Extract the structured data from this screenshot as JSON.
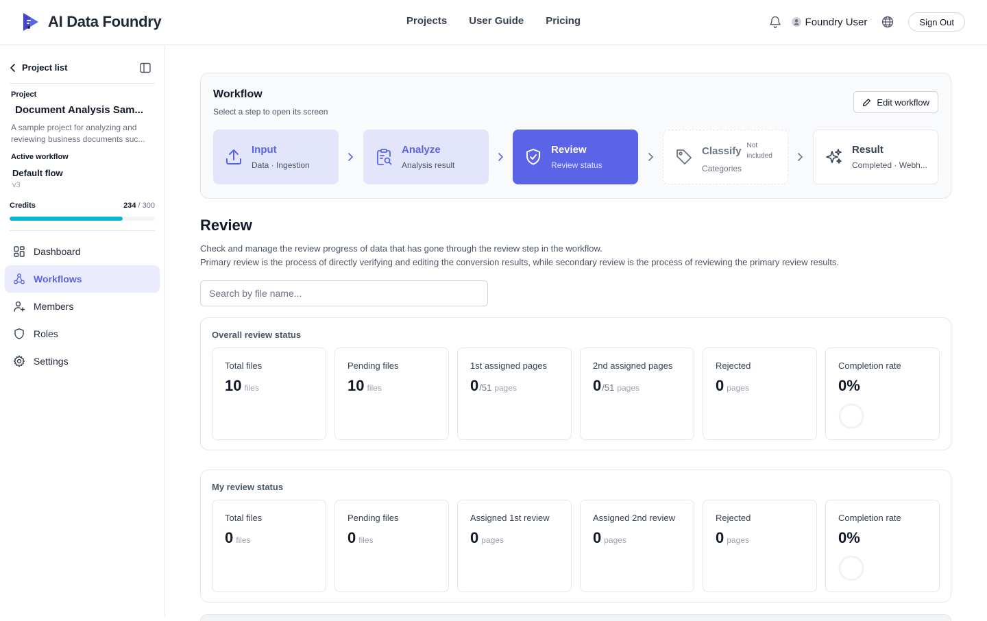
{
  "brand": {
    "name": "AI Data Foundry"
  },
  "topnav": {
    "items": [
      "Projects",
      "User Guide",
      "Pricing"
    ]
  },
  "user": {
    "name": "Foundry User",
    "signout": "Sign Out"
  },
  "sidebar": {
    "back_label": "Project list",
    "project_label": "Project",
    "project_name": "Document Analysis Sam...",
    "description_line1": "A sample project for analyzing and",
    "description_line2": "reviewing business documents suc...",
    "active_workflow_label": "Active workflow",
    "workflow_name": "Default flow",
    "workflow_version": "v3",
    "credits_label": "Credits",
    "credits_used": "234",
    "credits_total": "/ 300",
    "credits_fraction": 0.78,
    "menu": [
      {
        "label": "Dashboard",
        "icon": "dashboard-icon",
        "active": false
      },
      {
        "label": "Workflows",
        "icon": "workflow-icon",
        "active": true
      },
      {
        "label": "Members",
        "icon": "add-user-icon",
        "active": false
      },
      {
        "label": "Roles",
        "icon": "shield-icon",
        "active": false
      },
      {
        "label": "Settings",
        "icon": "gear-icon",
        "active": false
      }
    ]
  },
  "workflow": {
    "title": "Workflow",
    "subtitle": "Select a step to open its screen",
    "edit_label": "Edit workflow",
    "steps": [
      {
        "title": "Input",
        "subtitle": "Data · Ingestion",
        "icon": "upload-icon"
      },
      {
        "title": "Analyze",
        "subtitle": "Analysis result",
        "icon": "clipboard-search-icon"
      },
      {
        "title": "Review",
        "subtitle": "Review status",
        "icon": "shield-check-icon"
      },
      {
        "title": "Classify",
        "subtitle": "Categories",
        "note_line1": "Not",
        "note_line2": "included",
        "icon": "tag-icon"
      },
      {
        "title": "Result",
        "subtitle": "Completed · Webh...",
        "icon": "sparkles-icon"
      }
    ]
  },
  "review": {
    "title": "Review",
    "desc_line1": "Check and manage the review progress of data that has gone through the review step in the workflow.",
    "desc_line2": "Primary review is the process of directly verifying and editing the conversion results, while secondary review is the process of reviewing the primary review results.",
    "search_placeholder": "Search by file name..."
  },
  "overall": {
    "title": "Overall review status",
    "tiles": [
      {
        "label": "Total files",
        "value": "10",
        "den": "",
        "unit": "files"
      },
      {
        "label": "Pending files",
        "value": "10",
        "den": "",
        "unit": "files"
      },
      {
        "label": "1st assigned pages",
        "value": "0",
        "den": "/51",
        "unit": "pages"
      },
      {
        "label": "2nd assigned pages",
        "value": "0",
        "den": "/51",
        "unit": "pages"
      },
      {
        "label": "Rejected",
        "value": "0",
        "den": "",
        "unit": "pages"
      },
      {
        "label": "Completion rate",
        "value": "0%",
        "den": "",
        "unit": "",
        "completion": 0
      }
    ]
  },
  "mine": {
    "title": "My review status",
    "tiles": [
      {
        "label": "Total files",
        "value": "0",
        "den": "",
        "unit": "files"
      },
      {
        "label": "Pending files",
        "value": "0",
        "den": "",
        "unit": "files"
      },
      {
        "label": "Assigned 1st review",
        "value": "0",
        "den": "",
        "unit": "pages"
      },
      {
        "label": "Assigned 2nd review",
        "value": "0",
        "den": "",
        "unit": "pages"
      },
      {
        "label": "Rejected",
        "value": "0",
        "den": "",
        "unit": "pages"
      },
      {
        "label": "Completion rate",
        "value": "0%",
        "den": "",
        "unit": "",
        "completion": 0
      }
    ]
  },
  "colors": {
    "accent": "#5b63e6",
    "accent_light": "#e3e6fb",
    "credit_bar": "#06b6d4"
  }
}
